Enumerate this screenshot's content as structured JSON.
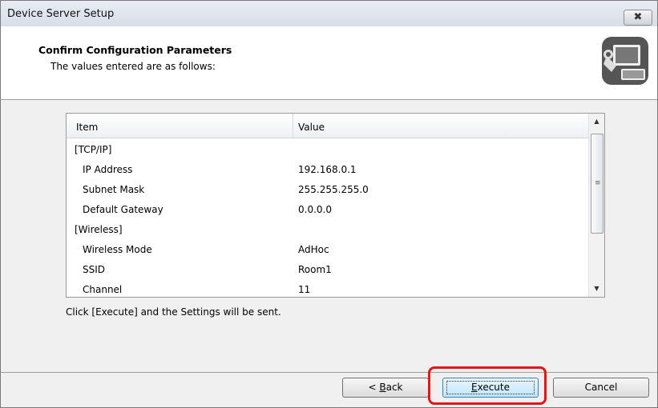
{
  "window": {
    "title": "Device Server Setup",
    "close_label": "✖"
  },
  "header": {
    "title": "Confirm Configuration Parameters",
    "subtitle": "The values entered are as follows:"
  },
  "list": {
    "columns": {
      "item": "Item",
      "value": "Value"
    },
    "rows": [
      {
        "item": "[TCP/IP]",
        "value": "",
        "indent": false
      },
      {
        "item": "IP Address",
        "value": "192.168.0.1",
        "indent": true
      },
      {
        "item": "Subnet Mask",
        "value": "255.255.255.0",
        "indent": true
      },
      {
        "item": "Default Gateway",
        "value": "0.0.0.0",
        "indent": true
      },
      {
        "item": "[Wireless]",
        "value": "",
        "indent": false
      },
      {
        "item": "Wireless Mode",
        "value": "AdHoc",
        "indent": true
      },
      {
        "item": "SSID",
        "value": "Room1",
        "indent": true
      },
      {
        "item": "Channel",
        "value": "11",
        "indent": true
      }
    ]
  },
  "hint": "Click [Execute] and the Settings will be sent.",
  "buttons": {
    "back": {
      "prefix": "< ",
      "mnemonic": "B",
      "rest": "ack"
    },
    "execute": {
      "mnemonic": "E",
      "rest": "xecute"
    },
    "cancel": "Cancel"
  },
  "colors": {
    "highlight": "#e0161c",
    "execute_accent": "#3c7fb1"
  }
}
